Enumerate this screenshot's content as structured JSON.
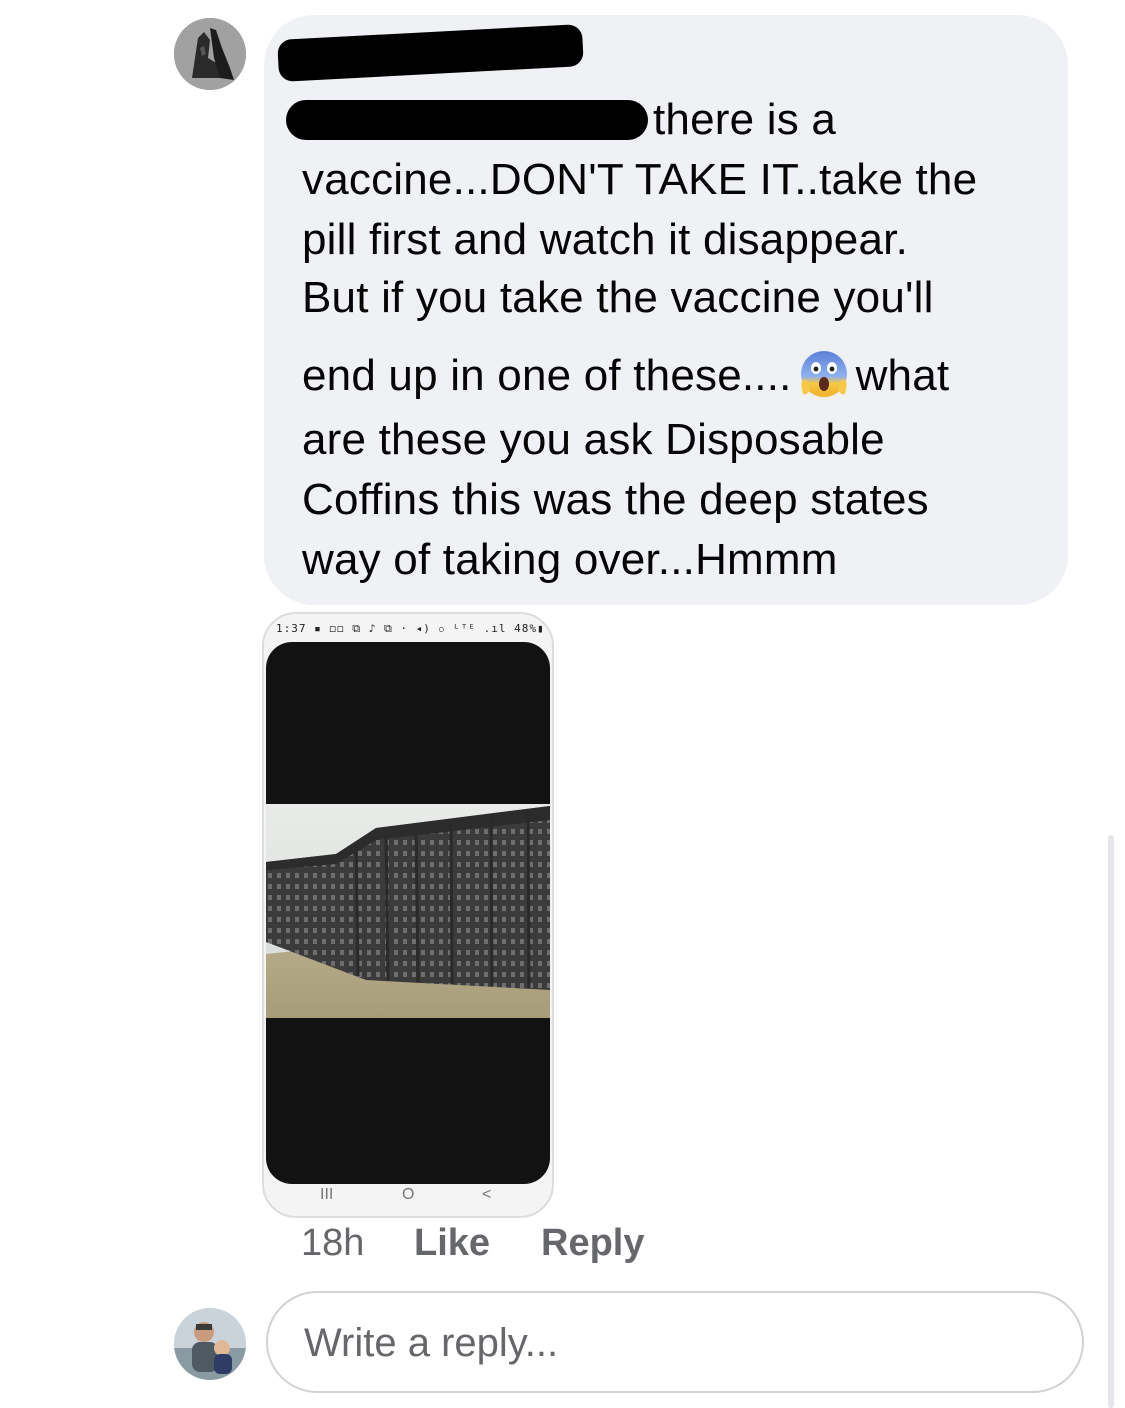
{
  "comment": {
    "lines": [
      "there is a",
      "vaccine...DON'T TAKE IT..take the",
      "pill first and watch it disappear.",
      "But if you take the vaccine you'll",
      "end up in one of these....",
      "what",
      "are these you ask Disposable",
      "Coffins this was the deep states",
      "way of taking over...Hmmm"
    ],
    "emoji_icon": "face-screaming-in-fear-icon"
  },
  "attachment": {
    "status_bar": "1:37 ▪ ◻◻ ⧉ ♪ ⧉ ·      ◂) ⚬ ᴸᵀᴱ .ıl 48%▮",
    "nav_keys": [
      "III",
      "O",
      "<"
    ]
  },
  "actions": {
    "time": "18h",
    "like": "Like",
    "reply": "Reply"
  },
  "reply_input": {
    "placeholder": "Write a reply..."
  }
}
